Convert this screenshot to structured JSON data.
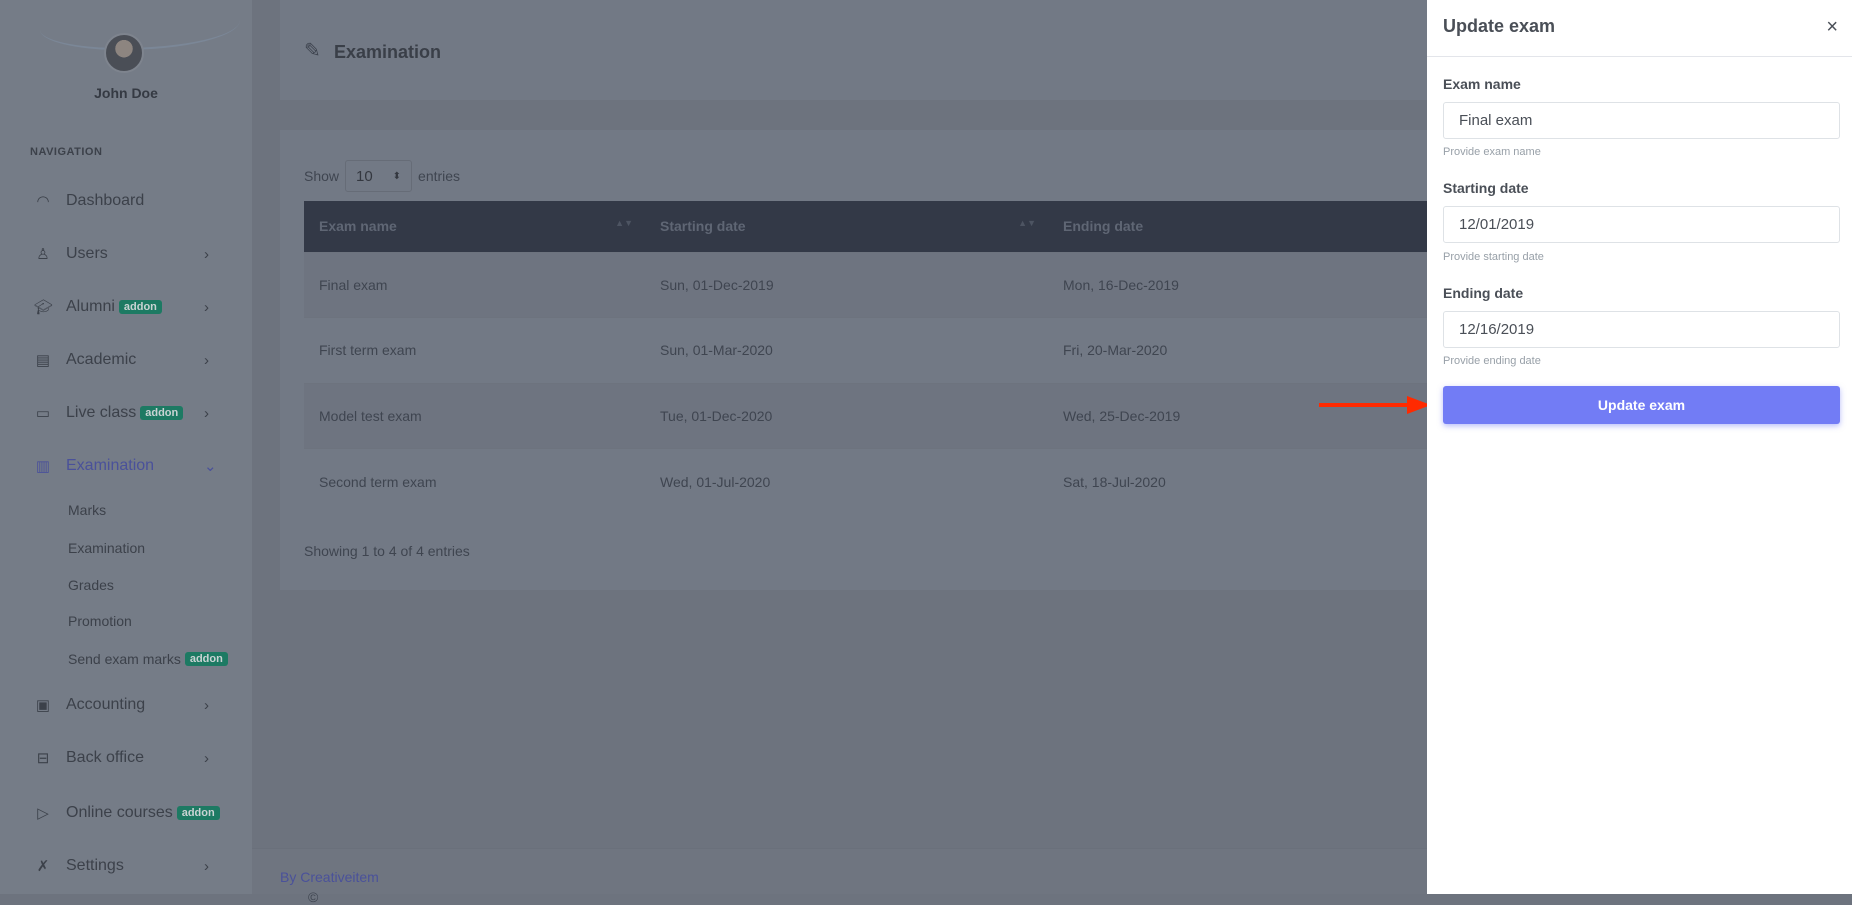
{
  "user": {
    "name": "John Doe"
  },
  "nav": {
    "heading": "NAVIGATION",
    "items": [
      {
        "label": "Dashboard",
        "icon": "dashboard-icon",
        "badge": null,
        "chevron": false
      },
      {
        "label": "Users",
        "icon": "user-icon",
        "badge": null,
        "chevron": true
      },
      {
        "label": "Alumni",
        "icon": "graduation-cap-icon",
        "badge": "addon",
        "chevron": true
      },
      {
        "label": "Academic",
        "icon": "building-icon",
        "badge": null,
        "chevron": true
      },
      {
        "label": "Live class",
        "icon": "video-icon",
        "badge": "addon",
        "chevron": true
      },
      {
        "label": "Examination",
        "icon": "clipboard-icon",
        "badge": null,
        "chevron": true,
        "active": true
      },
      {
        "label": "Accounting",
        "icon": "briefcase-icon",
        "badge": null,
        "chevron": true
      },
      {
        "label": "Back office",
        "icon": "basket-icon",
        "badge": null,
        "chevron": true
      },
      {
        "label": "Online courses",
        "icon": "play-icon",
        "badge": "addon",
        "chevron": false
      },
      {
        "label": "Settings",
        "icon": "tools-icon",
        "badge": null,
        "chevron": true
      }
    ],
    "subitems": [
      {
        "label": "Marks"
      },
      {
        "label": "Examination",
        "active": true
      },
      {
        "label": "Grades"
      },
      {
        "label": "Promotion"
      },
      {
        "label": "Send exam marks",
        "badge": "addon"
      }
    ]
  },
  "page": {
    "title": "Examination",
    "show_label": "Show",
    "entries_label": "entries",
    "page_size": "10",
    "columns": [
      "Exam name",
      "Starting date",
      "Ending date"
    ],
    "rows": [
      [
        "Final exam",
        "Sun, 01-Dec-2019",
        "Mon, 16-Dec-2019"
      ],
      [
        "First term exam",
        "Sun, 01-Mar-2020",
        "Fri, 20-Mar-2020"
      ],
      [
        "Model test exam",
        "Tue, 01-Dec-2020",
        "Wed, 25-Dec-2019"
      ],
      [
        "Second term exam",
        "Wed, 01-Jul-2020",
        "Sat, 18-Jul-2020"
      ]
    ],
    "info": "Showing 1 to 4 of 4 entries"
  },
  "footer": {
    "copy": "©",
    "link": "By Creativeitem"
  },
  "panel": {
    "title": "Update exam",
    "close": "×",
    "fields": [
      {
        "label": "Exam name",
        "value": "Final exam",
        "help": "Provide exam name"
      },
      {
        "label": "Starting date",
        "value": "12/01/2019",
        "help": "Provide starting date"
      },
      {
        "label": "Ending date",
        "value": "12/16/2019",
        "help": "Provide ending date"
      }
    ],
    "submit": "Update exam"
  },
  "colors": {
    "accent": "#727cf5",
    "badge": "#0acf97",
    "annotation_arrow": "#ff2a00"
  }
}
